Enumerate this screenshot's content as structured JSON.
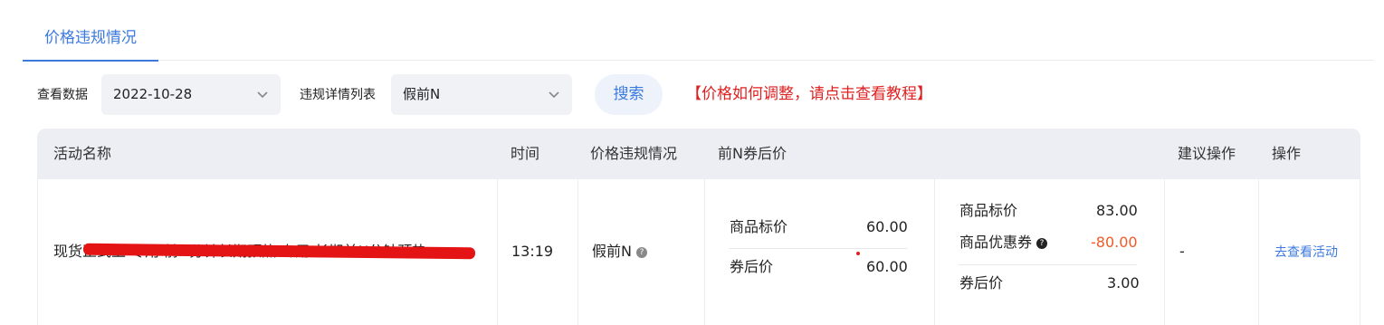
{
  "tabs": [
    {
      "label": "价格违规情况",
      "active": true
    }
  ],
  "filters": {
    "date_label": "查看数据",
    "date_value": "2022-10-28",
    "list_label": "违规详情列表",
    "list_value": "假前N",
    "search_label": "搜索",
    "tutorial_link": "【价格如何调整，请点击查看教程】"
  },
  "table": {
    "headers": {
      "activity_name": "活动名称",
      "time": "时间",
      "violation": "价格违规情况",
      "price_before_n": "前N券后价",
      "suggestion": "建议操作",
      "operation": "操作"
    },
    "rows": [
      {
        "activity_name": "现货正式上 专用 前N分钟长期预热 专用 长期前N分钟预热",
        "time": "13:19",
        "violation": "假前N",
        "before_n": {
          "list_price_label": "商品标价",
          "list_price": "60.00",
          "after_coupon_label": "券后价",
          "after_coupon": "60.00"
        },
        "current": {
          "list_price_label": "商品标价",
          "list_price": "83.00",
          "coupon_label": "商品优惠券",
          "coupon": "-80.00",
          "after_coupon_label": "券后价",
          "after_coupon": "3.00"
        },
        "suggestion": "-",
        "operation": "去查看活动"
      }
    ]
  },
  "colors": {
    "accent": "#3c7ae0",
    "danger": "#e02020",
    "coupon": "#f05a28"
  }
}
